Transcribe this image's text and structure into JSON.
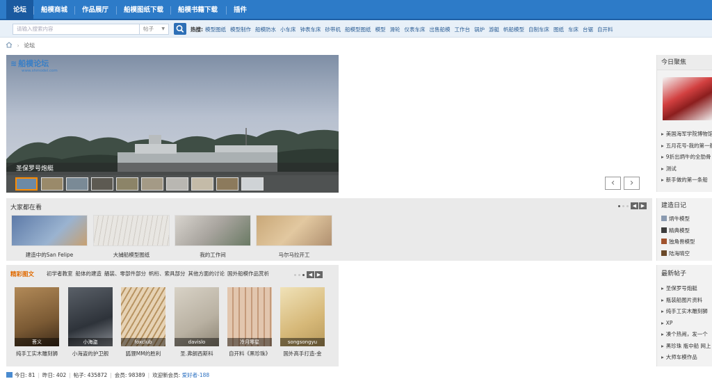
{
  "nav": {
    "items": [
      "论坛",
      "船模商城",
      "作品展厅",
      "船模图纸下载",
      "船模书籍下载",
      "插件"
    ]
  },
  "search": {
    "placeholder": "请输入搜索内容",
    "type": "帖子",
    "hot_label": "热搜:",
    "hot": [
      "模型图纸",
      "模型制作",
      "船模防水",
      "小车床",
      "钟表车床",
      "砂带机",
      "船模型图纸",
      "模型",
      "滑轮",
      "仪表车床",
      "出售船模",
      "工作台",
      "锅炉",
      "游艇",
      "帆船模型",
      "自制车床",
      "图纸",
      "车床",
      "台锯",
      "自开料"
    ]
  },
  "breadcrumb": {
    "current": "论坛"
  },
  "slideshow": {
    "logo_text": "船模论坛",
    "logo_url": "www.shmodel.com",
    "caption": "圣保罗号炮艇",
    "thumb_count": 10,
    "active_index": 0
  },
  "watching": {
    "title": "大家都在看",
    "items": [
      "建造中的San Felipe",
      "大捕船模型图纸",
      "我的工作间",
      "马尔马拉开工"
    ]
  },
  "featured": {
    "title": "精彩图文",
    "tabs": [
      "初学者教室",
      "船体的建造",
      "舾装、零部件部分",
      "帆桁、索具部分",
      "其他方面的讨论",
      "国外船模作品赏析"
    ],
    "items": [
      {
        "user": "菩义",
        "label": "纯手工实木雕刻狮"
      },
      {
        "user": "小海盗",
        "label": "小海盗的护卫舰"
      },
      {
        "user": "foxclub",
        "label": "狐狸MM的胜利"
      },
      {
        "user": "davislo",
        "label": "圣.弗朗西斯科"
      },
      {
        "user": "冷月零星",
        "label": "自开料《黑珍珠》"
      },
      {
        "user": "songsongyu",
        "label": "国外高手打造-金"
      }
    ]
  },
  "sidebar": {
    "focus": {
      "title": "今日聚焦",
      "items": [
        "美国海军学院博物馆",
        "五月花号-我的第一艘",
        "9折出炳牛的全肋骨",
        "测试",
        "新手做的第一条船"
      ]
    },
    "diary": {
      "title": "建造日记",
      "items": [
        "炳牛模型",
        "精典模型",
        "独角兽模型",
        "陆海晴空"
      ]
    },
    "latest": {
      "title": "最新帖子",
      "items": [
        "圣保罗号炮艇",
        "瓶装船图片资料",
        "纯手工实木雕刻狮",
        "XP",
        "凑个热闹，发一个",
        "黑珍珠 瓶中船 网上",
        "大师车模作品"
      ]
    }
  },
  "footer": {
    "today_label": "今日:",
    "today": "81",
    "yesterday_label": "昨日:",
    "yesterday": "402",
    "posts_label": "帖子:",
    "posts": "435872",
    "members_label": "会员:",
    "members": "98389",
    "welcome_label": "欢迎新会员:",
    "new_member": "爱好者-188"
  }
}
